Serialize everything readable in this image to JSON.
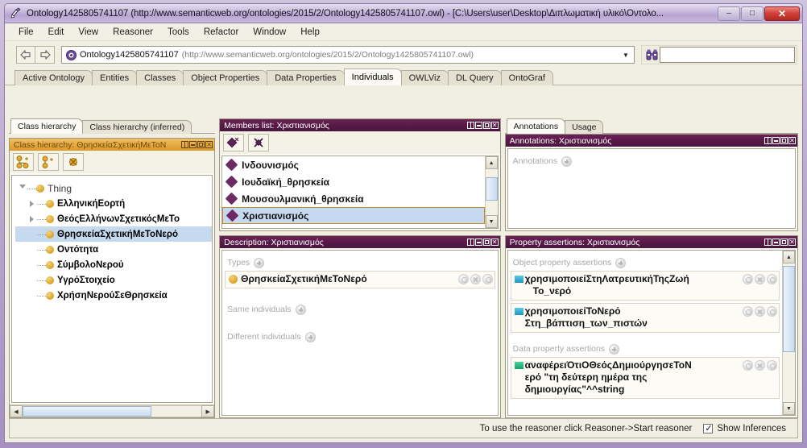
{
  "window": {
    "title": "Ontology1425805741107 (http://www.semanticweb.org/ontologies/2015/2/Ontology1425805741107.owl) - [C:\\Users\\user\\Desktop\\Διπλωματική υλικό\\Οντολο...",
    "icon": "protege-icon",
    "minimize_label": "–",
    "maximize_label": "□",
    "close_label": "✕"
  },
  "menubar": {
    "items": [
      "File",
      "Edit",
      "View",
      "Reasoner",
      "Tools",
      "Refactor",
      "Window",
      "Help"
    ]
  },
  "toolbar": {
    "back_icon": "arrow-left-icon",
    "forward_icon": "arrow-right-icon",
    "ontology_icon": "ontology-icon",
    "ontology_name": "Ontology1425805741107",
    "ontology_url": "(http://www.semanticweb.org/ontologies/2015/2/Ontology1425805741107.owl)",
    "dropdown_icon": "chevron-down-icon",
    "search_icon": "binoculars-icon",
    "search_value": "",
    "search_placeholder": ""
  },
  "tabs": {
    "items": [
      {
        "label": "Active Ontology",
        "active": false
      },
      {
        "label": "Entities",
        "active": false
      },
      {
        "label": "Classes",
        "active": false
      },
      {
        "label": "Object Properties",
        "active": false
      },
      {
        "label": "Data Properties",
        "active": false
      },
      {
        "label": "Individuals",
        "active": true
      },
      {
        "label": "OWLViz",
        "active": false
      },
      {
        "label": "DL Query",
        "active": false
      },
      {
        "label": "OntoGraf",
        "active": false
      }
    ]
  },
  "class_hierarchy": {
    "tabs": [
      {
        "label": "Class hierarchy",
        "active": true
      },
      {
        "label": "Class hierarchy (inferred)",
        "active": false
      }
    ],
    "panel_title": "Class hierarchy: ΘρησκείαΣχετικήΜεΤοΝ",
    "toolbar_icons": [
      "add-subclass-icon",
      "add-sibling-class-icon",
      "delete-class-icon"
    ],
    "tree": [
      {
        "label": "Thing",
        "depth": 0,
        "arrow": "down",
        "selected": false,
        "root": true
      },
      {
        "label": "ΕλληνικήΕορτή",
        "depth": 1,
        "arrow": "right",
        "selected": false
      },
      {
        "label": "ΘεόςΕλλήνωνΣχετικόςΜεΤο",
        "depth": 1,
        "arrow": "right",
        "selected": false
      },
      {
        "label": "ΘρησκείαΣχετικήΜεΤοΝερό",
        "depth": 1,
        "arrow": "none",
        "selected": true
      },
      {
        "label": "Οντότητα",
        "depth": 1,
        "arrow": "none",
        "selected": false
      },
      {
        "label": "ΣύμβολοΝερού",
        "depth": 1,
        "arrow": "none",
        "selected": false
      },
      {
        "label": "ΥγρόΣτοιχείο",
        "depth": 1,
        "arrow": "none",
        "selected": false
      },
      {
        "label": "ΧρήσηΝερούΣεΘρησκεία",
        "depth": 1,
        "arrow": "none",
        "selected": false
      }
    ],
    "scroll_left_icon": "scroll-left-icon",
    "scroll_right_icon": "scroll-right-icon"
  },
  "members_list": {
    "panel_title": "Members list: Χριστιανισμός",
    "toolbar_icons": [
      "add-individual-icon",
      "delete-individual-icon"
    ],
    "items": [
      {
        "label": "Ινδουνισμός",
        "selected": false
      },
      {
        "label": "Ιουδαϊκή_θρησκεία",
        "selected": false
      },
      {
        "label": "Μουσουλμανική_θρησκεία",
        "selected": false
      },
      {
        "label": "Χριστιανισμός",
        "selected": true
      }
    ],
    "scroll_up_icon": "scroll-up-icon",
    "scroll_down_icon": "scroll-down-icon"
  },
  "description": {
    "panel_title": "Description: Χριστιανισμός",
    "sections": [
      {
        "header": "Types",
        "rows": [
          {
            "label": "ΘρησκείαΣχετικήΜεΤοΝερό",
            "bullet": "class-circle-icon"
          }
        ]
      },
      {
        "header": "Same individuals",
        "rows": []
      },
      {
        "header": "Different individuals",
        "rows": []
      }
    ],
    "add_icon": "add-icon"
  },
  "annotations": {
    "tabs": [
      {
        "label": "Annotations",
        "active": true
      },
      {
        "label": "Usage",
        "active": false
      }
    ],
    "panel_title": "Annotations: Χριστιανισμός",
    "section_header": "Annotations",
    "add_icon": "add-icon"
  },
  "property_assertions": {
    "panel_title": "Property assertions: Χριστιανισμός",
    "sections": [
      {
        "header": "Object property assertions",
        "rows": [
          {
            "line1": "χρησιμοποιείΣτηΛατρευτικήΤηςΖωή",
            "line2": "Το_νερό",
            "bullet": "object-property-icon"
          },
          {
            "line1": "χρησιμοποιείΤοΝερό",
            "line2": "Στη_βάπτιση_των_πιστών",
            "bullet": "object-property-icon"
          }
        ]
      },
      {
        "header": "Data property assertions",
        "rows": [
          {
            "line1": "αναφέρειΌτιΟΘεόςΔημιούργησεΤοΝ",
            "line2": "ερό  \"τη δεύτερη ημέρα της",
            "line3": "δημιουργίας\"^^string",
            "bullet": "data-property-icon"
          }
        ]
      }
    ],
    "add_icon": "add-icon",
    "scroll_up_icon": "scroll-up-icon",
    "scroll_down_icon": "scroll-down-icon"
  },
  "statusbar": {
    "message": "To use the reasoner click Reasoner->Start reasoner",
    "checkbox_label": "Show Inferences",
    "checkbox_checked": true
  },
  "colors": {
    "panel_title_bg": "#551945",
    "panel_title_active_bg": "#e5a93f",
    "selection_bg": "#c5d9ef",
    "window_chrome": "#b9a7cd",
    "individual_marker": "#6b2a63",
    "class_marker": "#d8a326",
    "object_property_marker": "#2196c4",
    "data_property_marker": "#12a26b"
  }
}
